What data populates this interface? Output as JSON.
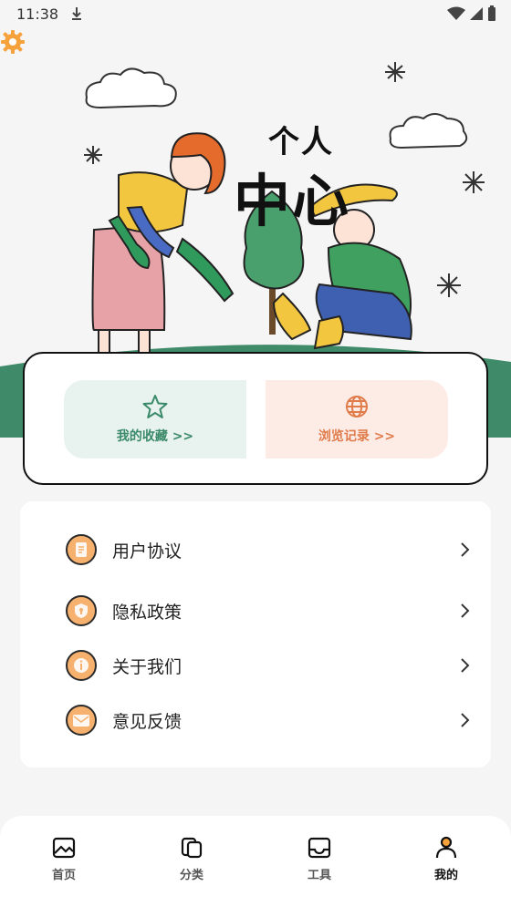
{
  "status_bar": {
    "time": "11:38"
  },
  "hero": {
    "title_line1": "个人",
    "title_line2": "中心"
  },
  "quick": {
    "favorites_label": "我的收藏 >>",
    "history_label": "浏览记录 >>"
  },
  "menu": {
    "items": [
      {
        "label": "用户协议",
        "icon": "document-icon"
      },
      {
        "label": "隐私政策",
        "icon": "shield-icon"
      },
      {
        "label": "关于我们",
        "icon": "info-icon"
      },
      {
        "label": "意见反馈",
        "icon": "mail-icon"
      }
    ]
  },
  "nav": {
    "tabs": [
      {
        "label": "首页",
        "icon": "image-icon"
      },
      {
        "label": "分类",
        "icon": "category-icon"
      },
      {
        "label": "工具",
        "icon": "inbox-icon"
      },
      {
        "label": "我的",
        "icon": "user-icon",
        "active": true
      }
    ]
  },
  "colors": {
    "accent": "#f6a23c",
    "green": "#3a8a6a",
    "orange": "#e07b4a"
  }
}
